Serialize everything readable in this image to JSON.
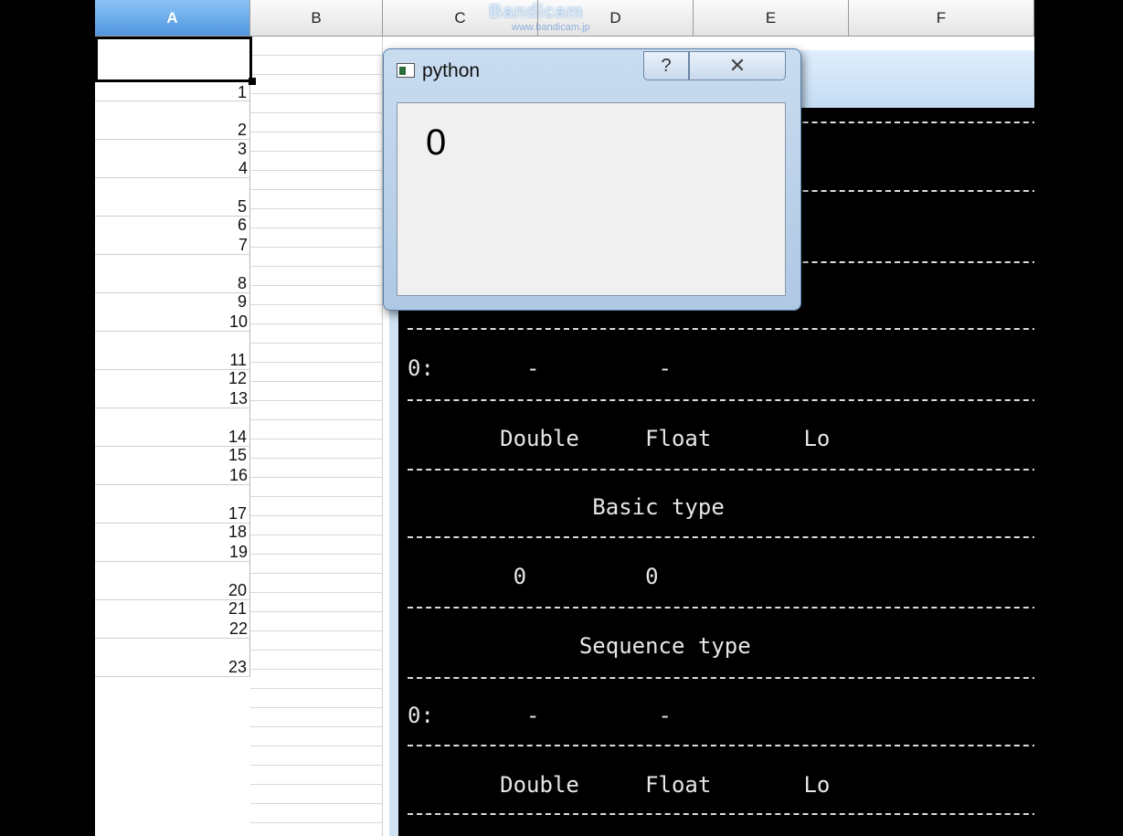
{
  "spreadsheet": {
    "columns": [
      "A",
      "B",
      "C",
      "D",
      "E",
      "F"
    ],
    "selected_column": "A",
    "row_numbers": [
      "1",
      "2",
      "3",
      "4",
      "5",
      "6",
      "7",
      "8",
      "9",
      "10",
      "11",
      "12",
      "13",
      "14",
      "15",
      "16",
      "17",
      "18",
      "19",
      "20",
      "21",
      "22",
      "23"
    ]
  },
  "watermark": {
    "text": "Bandicam",
    "url": "www.bandicam.jp"
  },
  "console": {
    "lines": [
      "              Basic type",
      "              0",
      "             Sequence type",
      "0:       -         -",
      "       Double     Float       Lo",
      "              Basic type",
      "        0         0",
      "             Sequence type",
      "0:       -         -",
      "       Double     Float       Lo"
    ]
  },
  "dialog": {
    "title": "python",
    "help_button": "?",
    "close_button": "✕",
    "value": "0"
  }
}
